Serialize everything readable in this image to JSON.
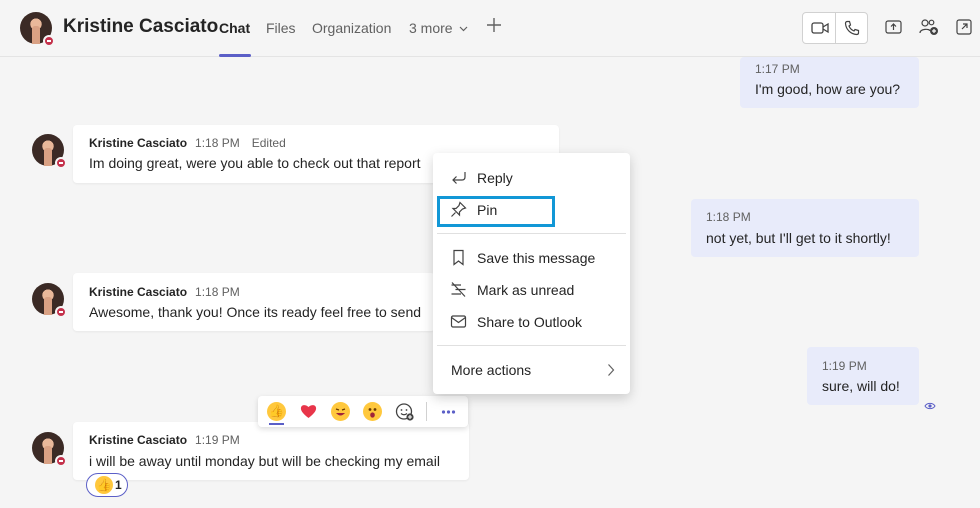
{
  "header": {
    "name": "Kristine Casciato",
    "tabs": [
      "Chat",
      "Files",
      "Organization",
      "3 more"
    ]
  },
  "messages": [
    {
      "side": "out",
      "time": "1:17 PM",
      "text": "I'm good, how are you?"
    },
    {
      "side": "in",
      "author": "Kristine Casciato",
      "time": "1:18 PM",
      "edited": "Edited",
      "text": "Im doing great, were you able to check out that report"
    },
    {
      "side": "out",
      "time": "1:18 PM",
      "text": "not yet, but I'll get to it shortly!"
    },
    {
      "side": "in",
      "author": "Kristine Casciato",
      "time": "1:18 PM",
      "text": "Awesome, thank you! Once its ready feel free to send"
    },
    {
      "side": "out",
      "time": "1:19 PM",
      "text": "sure, will do!"
    },
    {
      "side": "in",
      "author": "Kristine Casciato",
      "time": "1:19 PM",
      "text": "i will be away until monday but will be checking my email"
    }
  ],
  "reaction_count": "1",
  "context_menu": {
    "reply": "Reply",
    "pin": "Pin",
    "save": "Save this message",
    "mark_unread": "Mark as unread",
    "share_outlook": "Share to Outlook",
    "more_actions": "More actions"
  },
  "colors": {
    "accent": "#5b5fc7",
    "highlight": "#1197d6",
    "presence": "#c4314b",
    "out_bubble": "#e8ebfa"
  }
}
